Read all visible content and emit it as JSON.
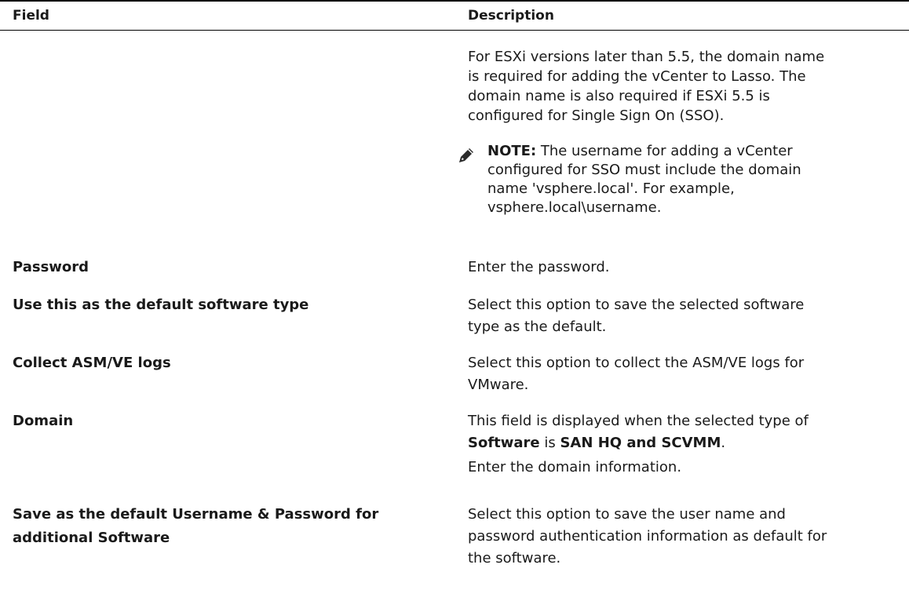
{
  "header": {
    "field": "Field",
    "description": "Description"
  },
  "intro": {
    "lines": [
      "For ESXi versions later than 5.5, the domain name",
      "is required for adding the vCenter to Lasso. The",
      "domain name is also required if ESXi 5.5 is",
      "configured for Single Sign On (SSO)."
    ]
  },
  "note": {
    "icon": "pencil-note-icon",
    "label": "NOTE:",
    "lines": [
      " The username for adding a vCenter",
      "configured for SSO must include the domain",
      "name 'vsphere.local'. For example,",
      "vsphere.local\\username."
    ]
  },
  "rows": {
    "password": {
      "field": "Password",
      "desc": [
        "Enter the password."
      ]
    },
    "default_type": {
      "field": "Use this as the default software type",
      "desc": [
        "Select this option to save the selected software",
        "type as the default."
      ]
    },
    "logs": {
      "field": "Collect ASM/VE logs",
      "desc": [
        "Select this option to collect the ASM/VE logs for",
        "VMware."
      ]
    },
    "domain": {
      "field": "Domain",
      "desc_prefix": "This field is displayed when the selected type of",
      "bold_software": "Software",
      "mid_is": " is ",
      "bold_san": "SAN HQ and SCVMM",
      "end_dot": ".",
      "desc_last": "Enter the domain information."
    },
    "save_default": {
      "field": [
        "Save as the default Username & Password for",
        "additional Software"
      ],
      "desc": [
        "Select this option to save the user name and",
        "password authentication information as default for",
        "the software."
      ]
    }
  }
}
